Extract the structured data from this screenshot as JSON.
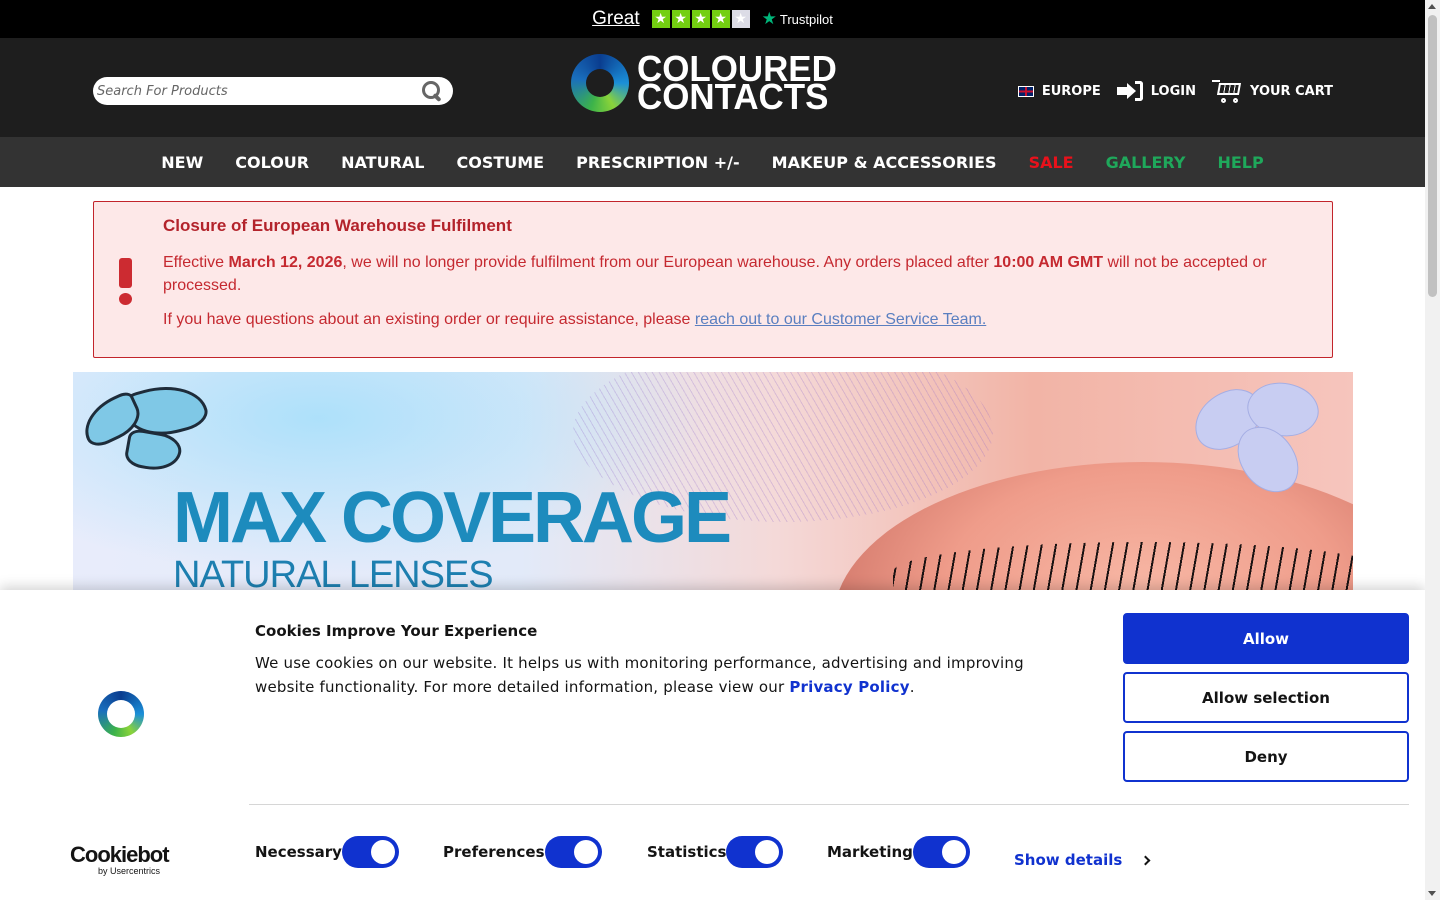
{
  "trustpilot": {
    "rating_text": "Great",
    "brand": "Trustpilot",
    "stars_filled": 4,
    "stars_total": 5
  },
  "header": {
    "search_placeholder": "Search For Products",
    "logo_line1": "COLOURED",
    "logo_line2": "CONTACTS",
    "region": "EUROPE",
    "login": "LOGIN",
    "cart": "YOUR CART"
  },
  "nav": {
    "items": [
      "NEW",
      "COLOUR",
      "NATURAL",
      "COSTUME",
      "PRESCRIPTION +/-",
      "MAKEUP & ACCESSORIES",
      "SALE",
      "GALLERY",
      "HELP"
    ]
  },
  "alert": {
    "title": "Closure of European Warehouse Fulfilment",
    "p1_a": "Effective ",
    "p1_date": "March 12, 2026",
    "p1_b": ", we will no longer provide fulfilment from our European warehouse. Any orders placed after ",
    "p1_time": "10:00 AM GMT",
    "p1_c": " will not be accepted or processed.",
    "p2_a": "If you have questions about an existing order or require assistance, please ",
    "p2_link": "reach out to our Customer Service Team."
  },
  "hero": {
    "title": "MAX COVERAGE",
    "subtitle": "NATURAL LENSES"
  },
  "cookie": {
    "title": "Cookies Improve Your Experience",
    "text": "We use cookies on our website. It helps us with monitoring performance, advertising and improving website functionality. For more detailed information, please view our ",
    "policy_link": "Privacy Policy",
    "text_end": ".",
    "allow": "Allow",
    "allow_selection": "Allow selection",
    "deny": "Deny",
    "brand_main": "Cookiebot",
    "brand_sub": "by Usercentrics",
    "toggles": [
      "Necessary",
      "Preferences",
      "Statistics",
      "Marketing"
    ],
    "show_details": "Show details"
  },
  "colors": {
    "accent": "#1032cf",
    "alert": "#c52930",
    "sale": "#e8111b",
    "nav_green": "#1fa85b"
  }
}
